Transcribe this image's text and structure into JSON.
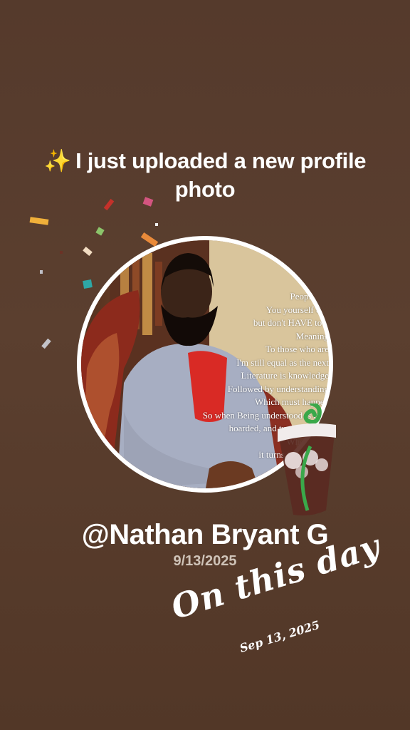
{
  "headline": {
    "icon": "sparkles-icon",
    "text": "I just uploaded a new profile photo"
  },
  "profile_photo": {
    "overlay_text_lines": [
      "People are",
      "You yourself can",
      "but don't HAVE to b",
      "Meaning",
      "To those who are",
      "I'm still equal as the next",
      "Literature is knowledge",
      "Followed by understanding",
      "Which must happen",
      "So when Being understood is capt",
      "hoarded, and turned into th",
      "When relea",
      "it turns into FOOD",
      "So",
      "Kno"
    ]
  },
  "username": "@Nathan Bryant G",
  "date": "9/13/2025",
  "memory": {
    "title": "On this day",
    "date": "Sep 13, 2025"
  },
  "colors": {
    "background": "#573c2d",
    "text": "#ffffff",
    "date_text": "#cfc3b8"
  },
  "stickers": [
    "confetti",
    "iced-drink-sticker"
  ]
}
